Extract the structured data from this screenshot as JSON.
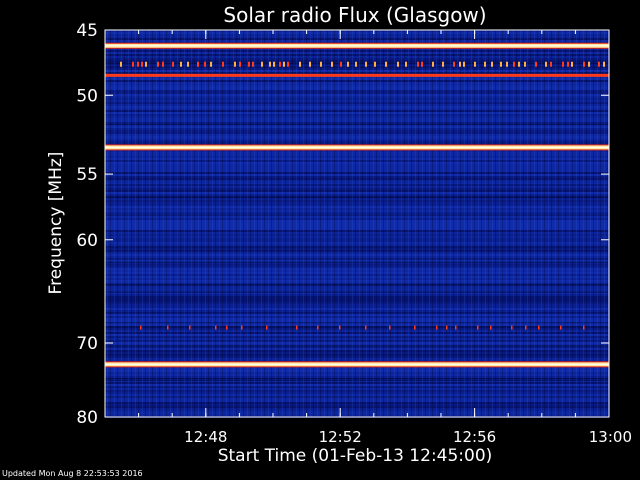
{
  "chart_data": {
    "type": "heatmap",
    "title": "Solar radio Flux (Glasgow)",
    "xlabel": "Start Time (01-Feb-13 12:45:00)",
    "ylabel": "Frequency [MHz]",
    "xlim": [
      "12:45",
      "13:00"
    ],
    "ylim": [
      80,
      45
    ],
    "x_ticks": [
      "12:48",
      "12:52",
      "12:56",
      "13:00"
    ],
    "y_ticks": [
      45,
      50,
      55,
      60,
      70,
      80
    ],
    "y_scale": "reciprocal",
    "colormap": "blue-black-red-yellow-white",
    "bright_bands_mhz": [
      47.3,
      53.2,
      72.5
    ],
    "intermittent_bands_mhz": [
      48.3,
      68.3
    ],
    "colors": {
      "background": "#000000",
      "base": "#0a1f8f",
      "band": "#ffe9a0",
      "spike": "#ff3a1a"
    }
  },
  "footer": {
    "updated": "Updated Mon Aug  8 22:53:53 2016"
  }
}
